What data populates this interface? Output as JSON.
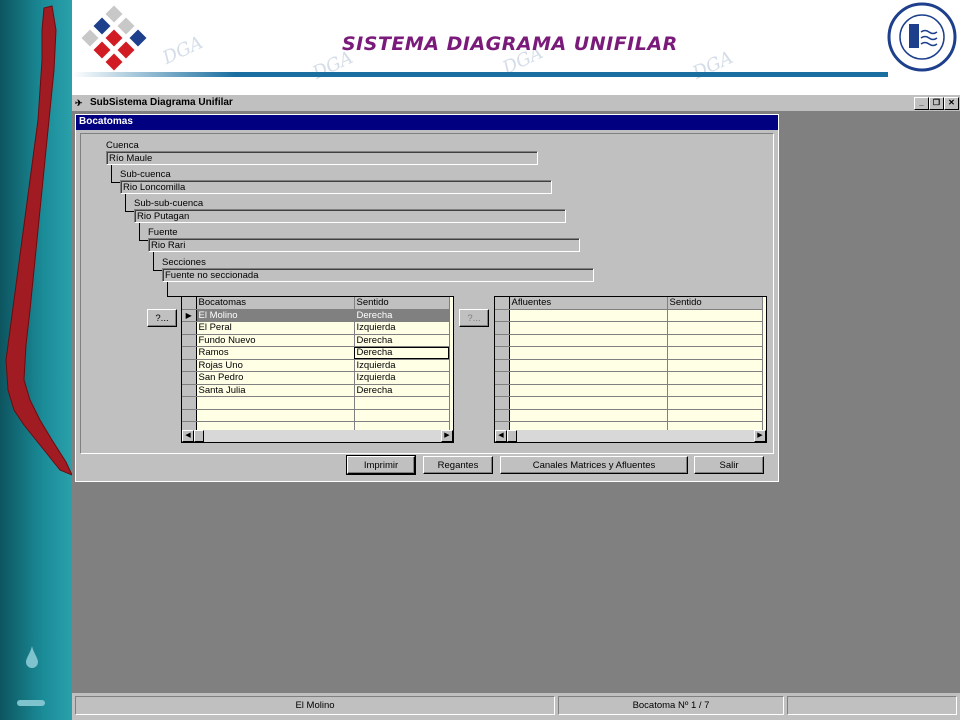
{
  "header": {
    "title": "SISTEMA DIAGRAMA UNIFILAR",
    "seal_text": "DIRECCION GENERAL DE AGUAS",
    "watermark_text": "DGA"
  },
  "window": {
    "title": "SubSistema Diagrama Unifilar",
    "controls": {
      "minimize": "_",
      "restore": "❐",
      "close": "✕"
    }
  },
  "child": {
    "title": "Bocatomas",
    "fields": [
      {
        "label": "Cuenca",
        "value": "Río Maule"
      },
      {
        "label": "Sub-cuenca",
        "value": "Rio Loncomilla"
      },
      {
        "label": "Sub-sub-cuenca",
        "value": "Rio Putagan"
      },
      {
        "label": "Fuente",
        "value": "Rio Rari"
      },
      {
        "label": "Secciones",
        "value": "Fuente no seccionada"
      }
    ],
    "lookup_button": "?...",
    "bocatomas_grid": {
      "columns": [
        "Bocatomas",
        "Sentido"
      ],
      "rows": [
        [
          "El Molino",
          "Derecha"
        ],
        [
          "El Peral",
          "Izquierda"
        ],
        [
          "Fundo Nuevo",
          "Derecha"
        ],
        [
          "Ramos",
          "Derecha"
        ],
        [
          "Rojas Uno",
          "Izquierda"
        ],
        [
          "San Pedro",
          "Izquierda"
        ],
        [
          "Santa Julia",
          "Derecha"
        ],
        [
          "",
          ""
        ],
        [
          "",
          ""
        ],
        [
          "",
          ""
        ]
      ]
    },
    "afluentes_grid": {
      "columns": [
        "Afluentes",
        "Sentido"
      ],
      "rows": [
        [
          "",
          ""
        ],
        [
          "",
          ""
        ],
        [
          "",
          ""
        ],
        [
          "",
          ""
        ],
        [
          "",
          ""
        ],
        [
          "",
          ""
        ],
        [
          "",
          ""
        ],
        [
          "",
          ""
        ],
        [
          "",
          ""
        ],
        [
          "",
          ""
        ]
      ]
    },
    "buttons": {
      "imprimir": "Imprimir",
      "regantes": "Regantes",
      "canales": "Canales Matrices y Afluentes",
      "salir": "Salir"
    }
  },
  "status": {
    "left": "El Molino",
    "right": "Bocatoma Nº 1 / 7"
  }
}
